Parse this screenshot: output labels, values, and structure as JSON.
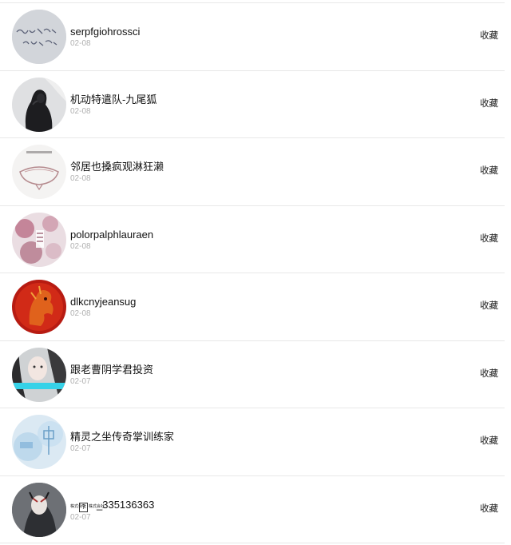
{
  "favorite_label": "收藏",
  "items": [
    {
      "name": "serpfgiohrossci",
      "date": "02-08",
      "avatar": "handwriting-avatar"
    },
    {
      "name": "机动特遣队-九尾狐",
      "date": "02-08",
      "avatar": "dark-portrait-avatar"
    },
    {
      "name": "邻居也搡疯观淋狂濑",
      "date": "02-08",
      "avatar": "sketch-avatar"
    },
    {
      "name": "polorpalphlauraen",
      "date": "02-08",
      "avatar": "blossom-avatar"
    },
    {
      "name": "dlkcnyjeansug",
      "date": "02-08",
      "avatar": "red-horse-avatar"
    },
    {
      "name": "跟老曹阴学君投资",
      "date": "02-07",
      "avatar": "girl-portrait-avatar"
    },
    {
      "name": "精灵之坐传奇掌训练家",
      "date": "02-07",
      "avatar": "blue-art-avatar"
    },
    {
      "name": "_335136363",
      "name_prefix": "株式会社",
      "name_mark": "?",
      "date": "02-07",
      "avatar": "anime-portrait-avatar"
    }
  ]
}
